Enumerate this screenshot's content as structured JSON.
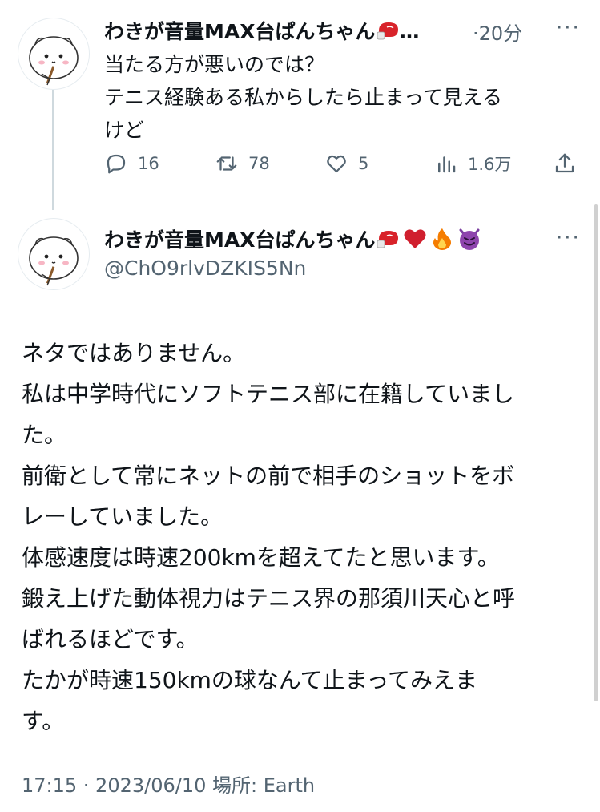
{
  "reply": {
    "author_name": "わきが音量MAX台ぱんちゃん",
    "ellipsis": "…",
    "separator": "·",
    "time": "20分",
    "more": "···",
    "text_lines": [
      "当たる方が悪いのでは？",
      "テニス経験ある私からしたら止まって見える",
      "けど"
    ],
    "stats": {
      "replies": "16",
      "retweets": "78",
      "likes": "5",
      "views": "1.6万"
    }
  },
  "tweet": {
    "author_name": "わきが音量MAX台ぱんちゃん",
    "handle": "@ChO9rlvDZKIS5Nn",
    "more": "···",
    "text_lines": [
      "ネタではありません。",
      "私は中学時代にソフトテニス部に在籍していまし",
      "た。",
      "前衛として常にネットの前で相手のショットをボ",
      "レーしていました。",
      "体感速度は時速200kmを超えてたと思います。",
      "鍛え上げた動体視力はテニス界の那須川天心と呼",
      "ばれるほどです。",
      "たかが時速150kmの球なんて止まってみえま",
      "す。"
    ],
    "meta": "17:15 · 2023/06/10 場所: Earth"
  },
  "icons": [
    "boxing-glove-icon",
    "red-heart-icon",
    "fire-icon",
    "smiling-devil-icon",
    "reply-icon",
    "retweet-icon",
    "like-icon",
    "views-icon",
    "share-icon",
    "more-icon"
  ],
  "colors": {
    "text": "#0f1419",
    "secondary": "#536471",
    "thread_line": "#cfd9de"
  }
}
